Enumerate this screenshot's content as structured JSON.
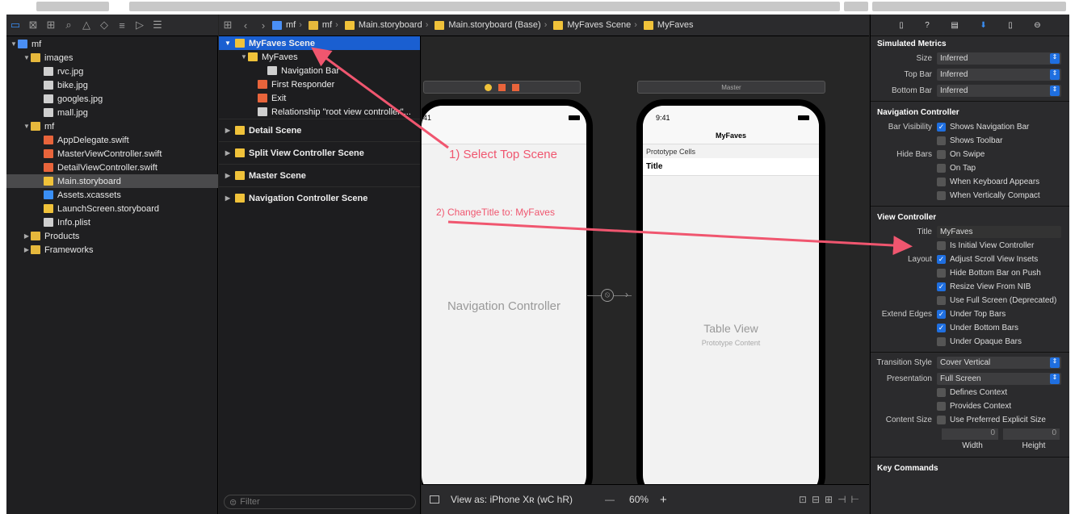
{
  "navigator": {
    "items": [
      {
        "label": "mf",
        "indent": 0,
        "disc": "▼",
        "icon": "proj"
      },
      {
        "label": "images",
        "indent": 1,
        "disc": "▼",
        "icon": "folder"
      },
      {
        "label": "rvc.jpg",
        "indent": 2,
        "disc": "",
        "icon": "file"
      },
      {
        "label": "bike.jpg",
        "indent": 2,
        "disc": "",
        "icon": "file"
      },
      {
        "label": "googles.jpg",
        "indent": 2,
        "disc": "",
        "icon": "file"
      },
      {
        "label": "mall.jpg",
        "indent": 2,
        "disc": "",
        "icon": "file"
      },
      {
        "label": "mf",
        "indent": 1,
        "disc": "▼",
        "icon": "folder"
      },
      {
        "label": "AppDelegate.swift",
        "indent": 2,
        "disc": "",
        "icon": "swift"
      },
      {
        "label": "MasterViewController.swift",
        "indent": 2,
        "disc": "",
        "icon": "swift"
      },
      {
        "label": "DetailViewController.swift",
        "indent": 2,
        "disc": "",
        "icon": "swift"
      },
      {
        "label": "Main.storyboard",
        "indent": 2,
        "disc": "",
        "icon": "sb",
        "selected": true
      },
      {
        "label": "Assets.xcassets",
        "indent": 2,
        "disc": "",
        "icon": "assets"
      },
      {
        "label": "LaunchScreen.storyboard",
        "indent": 2,
        "disc": "",
        "icon": "sb"
      },
      {
        "label": "Info.plist",
        "indent": 2,
        "disc": "",
        "icon": "file"
      },
      {
        "label": "Products",
        "indent": 1,
        "disc": "▶",
        "icon": "folder"
      },
      {
        "label": "Frameworks",
        "indent": 1,
        "disc": "▶",
        "icon": "folder"
      }
    ]
  },
  "jumpbar": {
    "crumbs": [
      "mf",
      "mf",
      "Main.storyboard",
      "Main.storyboard (Base)",
      "MyFaves Scene",
      "MyFaves"
    ]
  },
  "outline": {
    "top": {
      "label": "MyFaves Scene"
    },
    "children": [
      {
        "label": "MyFaves",
        "indent": 1,
        "icon": "sb"
      },
      {
        "label": "Navigation Bar",
        "indent": 3,
        "icon": "file"
      },
      {
        "label": "First Responder",
        "indent": 2,
        "icon": "swift"
      },
      {
        "label": "Exit",
        "indent": 2,
        "icon": "swift"
      },
      {
        "label": "Relationship \"root view controller\"...",
        "indent": 2,
        "icon": "file"
      }
    ],
    "scenes": [
      "Detail Scene",
      "Split View Controller Scene",
      "Master Scene",
      "Navigation Controller Scene"
    ],
    "filter_placeholder": "Filter"
  },
  "canvas": {
    "nav_controller_label": "Navigation Controller",
    "phone1_time": "41",
    "master_bar": "Master",
    "phone2_time": "9:41",
    "phone2_title": "MyFaves",
    "prototype_cells": "Prototype Cells",
    "cell_title": "Title",
    "table_view": "Table View",
    "prototype_content": "Prototype Content"
  },
  "bottombar": {
    "view_as": "View as: iPhone Xʀ (wC hR)",
    "zoom": "60%",
    "minus": "—",
    "plus": "+"
  },
  "inspector": {
    "simulated": {
      "title": "Simulated Metrics",
      "rows": [
        {
          "label": "Size",
          "value": "Inferred"
        },
        {
          "label": "Top Bar",
          "value": "Inferred"
        },
        {
          "label": "Bottom Bar",
          "value": "Inferred"
        }
      ]
    },
    "navctrl": {
      "title": "Navigation Controller",
      "bar_visibility": "Bar Visibility",
      "shows_nav": "Shows Navigation Bar",
      "shows_toolbar": "Shows Toolbar",
      "hide_bars": "Hide Bars",
      "on_swipe": "On Swipe",
      "on_tap": "On Tap",
      "keyboard": "When Keyboard Appears",
      "compact": "When Vertically Compact"
    },
    "vc": {
      "title": "View Controller",
      "title_label": "Title",
      "title_value": "MyFaves",
      "is_initial": "Is Initial View Controller",
      "layout": "Layout",
      "adjust": "Adjust Scroll View Insets",
      "hide_bottom": "Hide Bottom Bar on Push",
      "resize": "Resize View From NIB",
      "full_screen": "Use Full Screen (Deprecated)",
      "extend": "Extend Edges",
      "under_top": "Under Top Bars",
      "under_bottom": "Under Bottom Bars",
      "under_opaque": "Under Opaque Bars",
      "transition_label": "Transition Style",
      "transition_value": "Cover Vertical",
      "presentation_label": "Presentation",
      "presentation_value": "Full Screen",
      "defines": "Defines Context",
      "provides": "Provides Context",
      "content_size": "Content Size",
      "preferred": "Use Preferred Explicit Size",
      "width": "Width",
      "height": "Height",
      "zero": "0"
    },
    "key_commands": "Key Commands"
  },
  "annotations": {
    "step1": "1) Select Top Scene",
    "step2": "2) ChangeTitle to: MyFaves",
    "accent": "#f0566f"
  }
}
